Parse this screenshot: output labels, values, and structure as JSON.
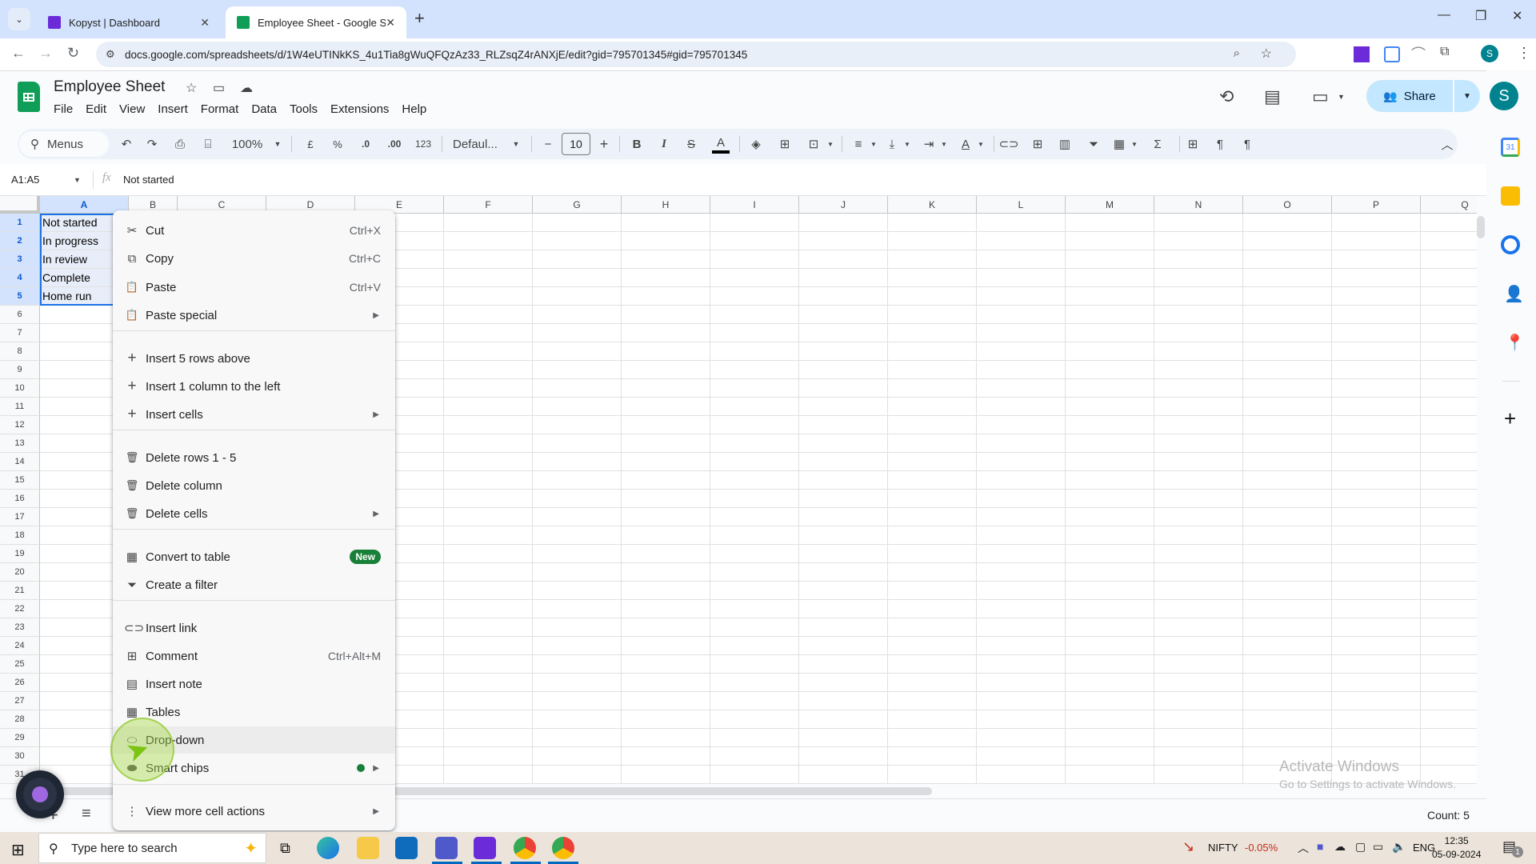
{
  "browser": {
    "tabs": [
      {
        "title": "Kopyst | Dashboard",
        "active": false
      },
      {
        "title": "Employee Sheet - Google Sheets",
        "active": true
      }
    ],
    "new_tab_label": "+",
    "url": "docs.google.com/spreadsheets/d/1W4eUTINkKS_4u1Tia8gWuQFQzAz33_RLZsqZ4rANXjE/edit?gid=795701345#gid=795701345",
    "profile_initial": "S"
  },
  "sheets": {
    "doc_title": "Employee Sheet",
    "menus": [
      "File",
      "Edit",
      "View",
      "Insert",
      "Format",
      "Data",
      "Tools",
      "Extensions",
      "Help"
    ],
    "share_label": "Share",
    "user_initial": "S",
    "toolbar": {
      "menus_search": "Menus",
      "zoom": "100%",
      "currency": "£",
      "percent": "%",
      "dec_decrease": ".0",
      "dec_increase": ".00",
      "number_format": "123",
      "font": "Defaul...",
      "font_size": "10"
    },
    "name_box": "A1:A5",
    "formula": "Not started",
    "columns": [
      "A",
      "B",
      "C",
      "D",
      "E",
      "F",
      "G",
      "H",
      "I",
      "J",
      "K",
      "L",
      "M",
      "N",
      "O",
      "P",
      "Q"
    ],
    "rows": [
      "1",
      "2",
      "3",
      "4",
      "5",
      "6",
      "7",
      "8",
      "9",
      "10",
      "11",
      "12",
      "13",
      "14",
      "15",
      "16",
      "17",
      "18",
      "19",
      "20",
      "21",
      "22",
      "23",
      "24",
      "25",
      "26",
      "27",
      "28",
      "29",
      "30",
      "31"
    ],
    "cells_A": [
      "Not started",
      "In progress",
      "In review",
      "Complete",
      "Home run"
    ],
    "status_count": "Count: 5"
  },
  "context_menu": {
    "items": [
      {
        "icon": "scissors-icon",
        "label": "Cut",
        "shortcut": "Ctrl+X"
      },
      {
        "icon": "copy-icon",
        "label": "Copy",
        "shortcut": "Ctrl+C"
      },
      {
        "icon": "clipboard-icon",
        "label": "Paste",
        "shortcut": "Ctrl+V"
      },
      {
        "icon": "clipboard-icon",
        "label": "Paste special",
        "submenu": true
      },
      {
        "icon": "plus-icon",
        "label": "Insert 5 rows above"
      },
      {
        "icon": "plus-icon",
        "label": "Insert 1 column to the left"
      },
      {
        "icon": "plus-icon",
        "label": "Insert cells",
        "submenu": true
      },
      {
        "icon": "trash-icon",
        "label": "Delete rows 1 - 5"
      },
      {
        "icon": "trash-icon",
        "label": "Delete column"
      },
      {
        "icon": "trash-icon",
        "label": "Delete cells",
        "submenu": true
      },
      {
        "icon": "table-icon",
        "label": "Convert to table",
        "badge": "New"
      },
      {
        "icon": "filter-icon",
        "label": "Create a filter"
      },
      {
        "icon": "link-icon",
        "label": "Insert link"
      },
      {
        "icon": "comment-icon",
        "label": "Comment",
        "shortcut": "Ctrl+Alt+M"
      },
      {
        "icon": "note-icon",
        "label": "Insert note"
      },
      {
        "icon": "table-icon",
        "label": "Tables"
      },
      {
        "icon": "dropdown-chip-icon",
        "label": "Drop-down",
        "hovered": true
      },
      {
        "icon": "smart-chip-icon",
        "label": "Smart chips",
        "submenu": true,
        "dot": true
      },
      {
        "icon": "more-vert-icon",
        "label": "View more cell actions",
        "submenu": true
      }
    ]
  },
  "watermark": {
    "line1": "Activate Windows",
    "line2": "Go to Settings to activate Windows."
  },
  "taskbar": {
    "search_placeholder": "Type here to search",
    "stock_name": "NIFTY",
    "stock_change": "-0.05%",
    "language": "ENG",
    "time": "12:35",
    "date": "05-09-2024",
    "notification_count": "1"
  },
  "colors": {
    "sheets_green": "#0f9d58",
    "selection_blue": "#1a73e8",
    "share_bg": "#c2e7ff",
    "new_badge": "#188038",
    "stock_red": "#c42b1c"
  }
}
